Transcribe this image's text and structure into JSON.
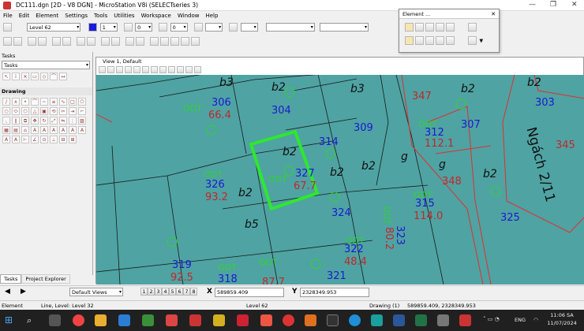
{
  "window": {
    "title": "DC111.dgn [2D - V8 DGN] - MicroStation V8i (SELECTseries 3)"
  },
  "menu": [
    "File",
    "Edit",
    "Element",
    "Settings",
    "Tools",
    "Utilities",
    "Workspace",
    "Window",
    "Help"
  ],
  "toolbar": {
    "level": "Level 62",
    "color": "1",
    "weight": "0",
    "style": "0"
  },
  "element_dialog": {
    "title": "Element ..."
  },
  "tasks": {
    "title": "Tasks",
    "dropdown": "Tasks",
    "drawing": "Drawing",
    "tabs": [
      "Tasks",
      "Project Explorer"
    ]
  },
  "view": {
    "title": "View 1, Default"
  },
  "map": {
    "blue": [
      "306",
      "304",
      "309",
      "314",
      "312",
      "307",
      "303",
      "327",
      "326",
      "324",
      "315",
      "325",
      "323",
      "322",
      "319",
      "318",
      "321"
    ],
    "red": [
      "66.4",
      "347",
      "112.1",
      "345",
      "67.7",
      "93.2",
      "348",
      "114.0",
      "80.2",
      "48.4",
      "92.5",
      "87.7"
    ],
    "black": [
      "b3",
      "b2",
      "b3",
      "b2",
      "b2",
      "b2",
      "b2",
      "g",
      "g",
      "b2",
      "b2",
      "b2",
      "b5",
      "Ngách 2/11"
    ],
    "green": [
      "ODT",
      "ODT",
      "ODT",
      "ODT",
      "ODT",
      "ODT",
      "ODT",
      "ODT",
      "ODT"
    ]
  },
  "statusbar": {
    "views_combo": "Default Views",
    "view_buttons": [
      "1",
      "2",
      "3",
      "4",
      "5",
      "6",
      "7",
      "8"
    ],
    "x_label": "X",
    "x_value": "589859.409",
    "y_label": "Y",
    "y_value": "2328349.953"
  },
  "infobar": {
    "element": "Element",
    "message": "Line, Level: Level 32",
    "level": "Level 62",
    "model": "Drawing (1)",
    "coords": "589859.409, 2328349.953"
  },
  "taskbar": {
    "lang": "ENG",
    "time": "11:06 SA",
    "date": "11/07/2024"
  }
}
